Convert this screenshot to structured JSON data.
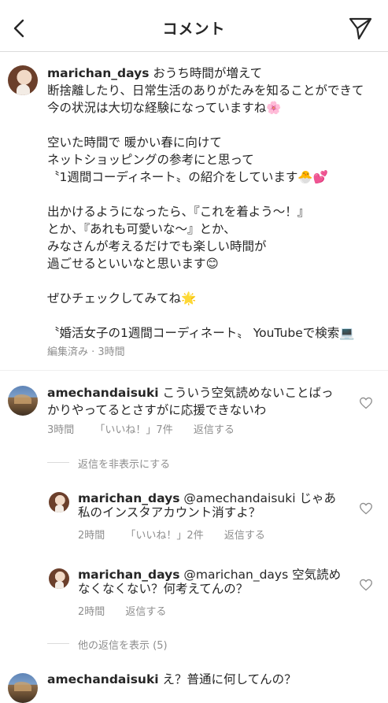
{
  "header": {
    "title": "コメント",
    "back_icon": "chevron-left-icon",
    "send_icon": "paper-plane-icon"
  },
  "caption": {
    "username": "marichan_days",
    "lines": [
      "おうち時間が増えて",
      "断捨離したり、日常生活のありがたみを知ることができて",
      "今の状況は大切な経験になっていますね🌸",
      "",
      "空いた時間で 暖かい春に向けて",
      "ネットショッピングの参考にと思って",
      "〝1週間コーディネート〟の紹介をしています🐣💕",
      "",
      "出かけるようになったら、『これを着よう〜！』",
      "とか、『あれも可愛いな〜』とか、",
      "みなさんが考えるだけでも楽しい時間が",
      "過ごせるといいなと思います😊",
      "",
      "ぜひチェックしてみてね🌟",
      "",
      "〝婚活女子の1週間コーディネート〟 YouTubeで検索💻"
    ],
    "meta": "編集済み · 3時間"
  },
  "comments": [
    {
      "username": "amechandaisuki",
      "text_line1": "こういう空気読めないことばっ",
      "text_line2": "かりやってるとさすがに応援できないわ",
      "time": "3時間",
      "likes": "「いいね！」7件",
      "reply": "返信する"
    }
  ],
  "hide_replies": "返信を非表示にする",
  "replies": [
    {
      "username": "marichan_days",
      "text_line1": "@amechandaisuki じゃあ",
      "text_line2": "私のインスタアカウント消すよ？",
      "time": "2時間",
      "likes": "「いいね！」2件",
      "reply": "返信する"
    },
    {
      "username": "marichan_days",
      "text_line1": "@marichan_days 空気読め",
      "text_line2": "なくなくない？何考えてんの？",
      "time": "2時間",
      "reply": "返信する"
    }
  ],
  "show_other_replies": "他の返信を表示 (5)",
  "last_comment": {
    "username": "amechandaisuki",
    "text": "え？普通に何してんの？"
  },
  "colors": {
    "text": "#262626",
    "secondary": "#8e8e8e",
    "divider": "#dbdbdb"
  }
}
